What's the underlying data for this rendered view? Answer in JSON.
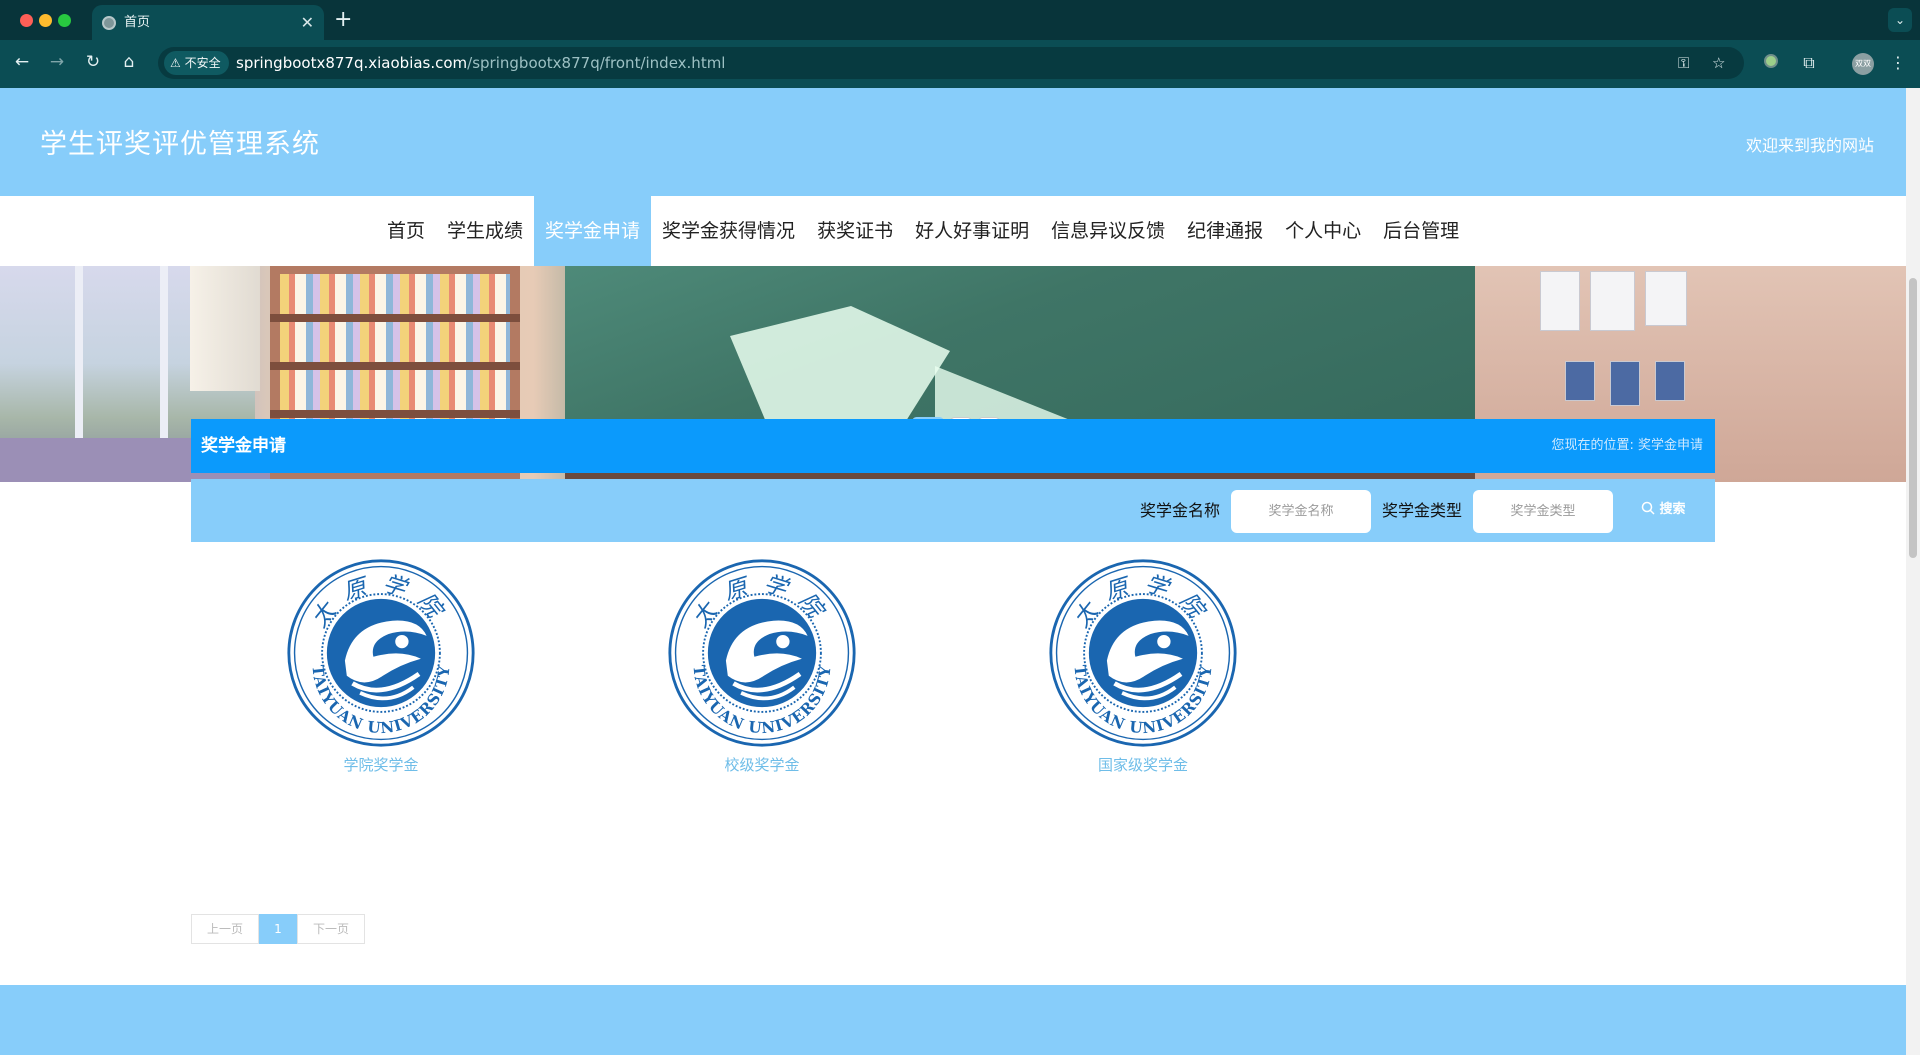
{
  "browser": {
    "tab_title": "首页",
    "security_label": "不安全",
    "url_host": "springbootx877q.xiaobias.com",
    "url_path": "/springbootx877q/front/index.html",
    "profile_label": "双双"
  },
  "site": {
    "title": "学生评奖评优管理系统",
    "welcome": "欢迎来到我的网站"
  },
  "nav": {
    "items": [
      {
        "label": "首页"
      },
      {
        "label": "学生成绩"
      },
      {
        "label": "奖学金申请"
      },
      {
        "label": "奖学金获得情况"
      },
      {
        "label": "获奖证书"
      },
      {
        "label": "好人好事证明"
      },
      {
        "label": "信息异议反馈"
      },
      {
        "label": "纪律通报"
      },
      {
        "label": "个人中心"
      },
      {
        "label": "后台管理"
      }
    ],
    "active_index": 2
  },
  "banner": {
    "slide_count": 3,
    "active_slide": 0
  },
  "section": {
    "title": "奖学金申请",
    "breadcrumb_prefix": "您现在的位置:",
    "breadcrumb_current": "奖学金申请"
  },
  "search": {
    "name_label": "奖学金名称",
    "name_placeholder": "奖学金名称",
    "type_label": "奖学金类型",
    "type_placeholder": "奖学金类型",
    "button_label": "搜索"
  },
  "scholarships": [
    {
      "name": "学院奖学金"
    },
    {
      "name": "校级奖学金"
    },
    {
      "name": "国家级奖学金"
    }
  ],
  "logo": {
    "top_text": "太原学院",
    "bottom_text": "TAIYUAN UNIVERSITY",
    "color": "#1a66b0"
  },
  "pagination": {
    "prev": "上一页",
    "current": "1",
    "next": "下一页"
  },
  "colors": {
    "header": "#87cdfa",
    "title_bar": "#0b9afc",
    "chrome": "#0b4d54"
  }
}
